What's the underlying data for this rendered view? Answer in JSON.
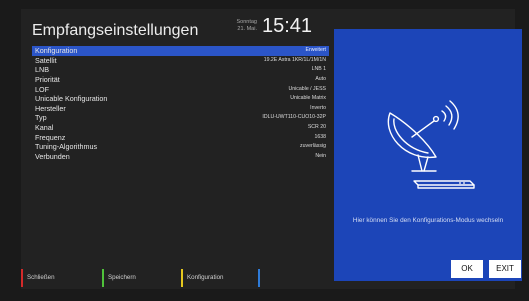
{
  "header": {
    "title": "Empfangseinstellungen",
    "day": "Sonntag",
    "date": "21. Mai.",
    "time": "15:41"
  },
  "settings": [
    {
      "label": "Konfiguration",
      "value": "Erweitert",
      "selected": true
    },
    {
      "label": "Satellit",
      "value": "19.2E Astra 1KR/1L/1M/1N"
    },
    {
      "label": "LNB",
      "value": "LNB 1"
    },
    {
      "label": "Priorität",
      "value": "Auto"
    },
    {
      "label": "LOF",
      "value": "Unicable / JESS"
    },
    {
      "label": "Unicable Konfiguration",
      "value": "Unicable Matrix"
    },
    {
      "label": "Hersteller",
      "value": "Inverto"
    },
    {
      "label": "Typ",
      "value": "IDLU-UWT110-CUO10-32P"
    },
    {
      "label": "Kanal",
      "value": "SCR 20"
    },
    {
      "label": "Frequenz",
      "value": "1638"
    },
    {
      "label": "Tuning-Algorithmus",
      "value": "zuverlässig"
    },
    {
      "label": "Verbunden",
      "value": "Nein"
    }
  ],
  "panel": {
    "help_text": "Hier können Sie den Konfigurations-Modus wechseln",
    "ok_label": "OK",
    "exit_label": "EXIT"
  },
  "footer": [
    {
      "label": "Schließen",
      "color": "#d42a2a"
    },
    {
      "label": "Speichern",
      "color": "#4fc23a"
    },
    {
      "label": "Konfiguration",
      "color": "#e6c81e"
    },
    {
      "label": "",
      "color": "#2e7bd8"
    }
  ],
  "colors": {
    "selection": "#2b55c8",
    "panel": "#1c45b8"
  }
}
